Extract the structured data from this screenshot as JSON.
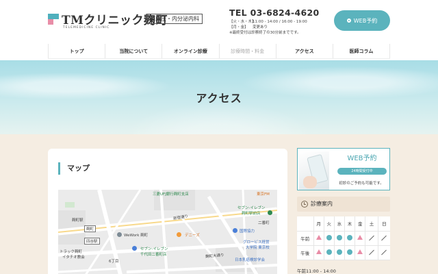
{
  "header": {
    "logo_text": "TMクリニック麹町",
    "logo_sub": "TELEMEDICINE CLINIC",
    "dept_badge": "高血圧・内分泌内科",
    "tel": "TEL 03-6824-4620",
    "hours": [
      {
        "label": "【火・水・木】",
        "value": "11:00 - 14:00 / 16:00 - 19:00"
      },
      {
        "label": "【月・金】",
        "value": "変更あり"
      },
      {
        "label": "",
        "value": "※最終受付は診察終了の30分前までです。"
      }
    ],
    "web_button": "WEB予約"
  },
  "nav": {
    "items": [
      {
        "label": "トップ",
        "active": true
      },
      {
        "label": "当院について",
        "active": true
      },
      {
        "label": "オンライン診療",
        "active": true
      },
      {
        "label": "診療時間・料金",
        "active": false
      },
      {
        "label": "アクセス",
        "active": true
      },
      {
        "label": "医師コラム",
        "active": true
      }
    ]
  },
  "hero": {
    "title": "アクセス"
  },
  "main": {
    "section_title": "マップ",
    "map_labels": {
      "bank": "三菱UFJ銀行麹町支店",
      "tokyo_fm": "東京FM",
      "seven_top": "セブン-イレブン",
      "seven_top2": "麹町駅前店",
      "nibancho": "二番町",
      "wework": "WeWork 麹町",
      "kojimachi_box": "麹町",
      "yotsuya_box": "四谷駅",
      "dennys": "デニーズ",
      "kokusai": "国際協力",
      "globis": "グロービス経営",
      "globis2": "大学院 東京校",
      "seven_bottom": "セブン-イレブン",
      "seven_bottom2": "千代田二番町店",
      "ohara": "日本乳癌検診学会",
      "hotel": "トラック麹町",
      "hotel2": "イタチオ教会",
      "rokucho": "6丁目",
      "kojimachi_st": "麹町駅",
      "street1": "新宿通り",
      "street2": "麹町大通り"
    }
  },
  "sidebar": {
    "promo_title": "WEB予約",
    "promo_badge": "24時間受付中",
    "promo_note": "初診のご予約も可能です。",
    "info_title": "診療案内",
    "schedule": {
      "days": [
        "月",
        "火",
        "水",
        "木",
        "金",
        "土",
        "日"
      ],
      "rows": [
        {
          "label": "午前",
          "marks": [
            "tri",
            "circle",
            "circle",
            "circle",
            "tri",
            "slash",
            "slash"
          ]
        },
        {
          "label": "午後",
          "marks": [
            "tri",
            "circle",
            "circle",
            "circle",
            "tri",
            "slash",
            "slash"
          ]
        }
      ]
    },
    "hours_foot": "午前11:00 - 14:00"
  },
  "colors": {
    "accent": "#5bb3bd",
    "pink": "#e98da7",
    "bg": "#f5ede2"
  }
}
